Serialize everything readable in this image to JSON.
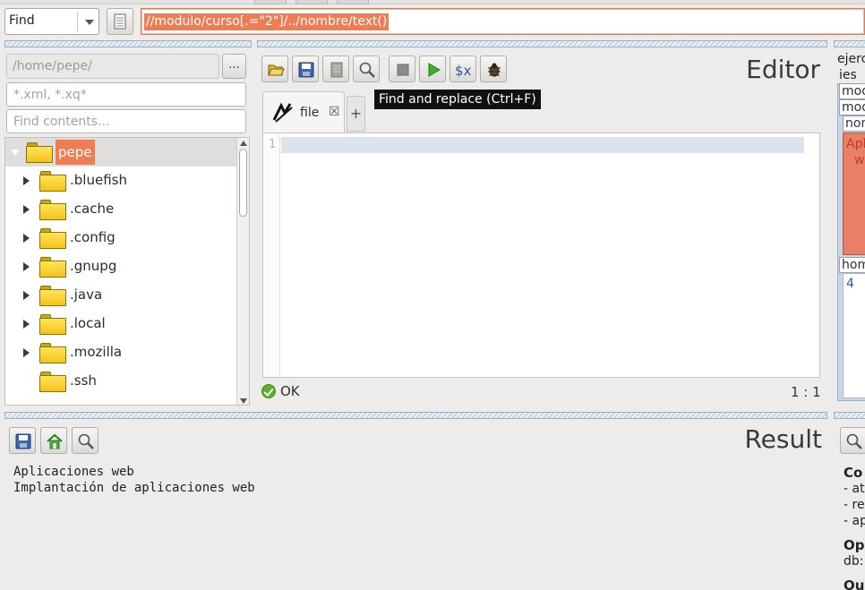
{
  "topbar": {
    "mode": "Find",
    "query": "//modulo/curso[.=\"2\"]/../nombre/text()"
  },
  "project": {
    "path_placeholder": "/home/pepe/",
    "browse_label": "...",
    "filter_placeholder": "*.xml, *.xq*",
    "contents_placeholder": "Find contents...",
    "tree": [
      {
        "label": "pepe",
        "root": true
      },
      {
        "label": ".bluefish",
        "expandable": true
      },
      {
        "label": ".cache",
        "expandable": true
      },
      {
        "label": ".config",
        "expandable": true
      },
      {
        "label": ".gnupg",
        "expandable": true
      },
      {
        "label": ".java",
        "expandable": true
      },
      {
        "label": ".local",
        "expandable": true
      },
      {
        "label": ".mozilla",
        "expandable": true
      },
      {
        "label": ".ssh",
        "expandable": false
      }
    ]
  },
  "editor": {
    "title": "Editor",
    "tab_label": "file",
    "tab_close": "☒",
    "tab_add": "+",
    "tooltip": "Find and replace (Ctrl+F)",
    "line_number": "1",
    "status": "OK",
    "position": "1 : 1"
  },
  "sidepanel": {
    "items": [
      "ejerc",
      "ies",
      "modu",
      "modu",
      "nom",
      "hom"
    ],
    "red_lines": [
      "Apl",
      "we"
    ],
    "value": "4"
  },
  "result": {
    "title": "Result",
    "lines": [
      "Aplicaciones web",
      "Implantación de aplicaciones web"
    ]
  },
  "info": {
    "heading1": "Co",
    "lines": [
      "- at",
      "- re",
      "- ap"
    ],
    "heading2": "Op",
    "db": "db:",
    "heading3": "Ou"
  },
  "colors": {
    "accent": "#ee7d55",
    "selection_bar": "#c6d5e6"
  }
}
